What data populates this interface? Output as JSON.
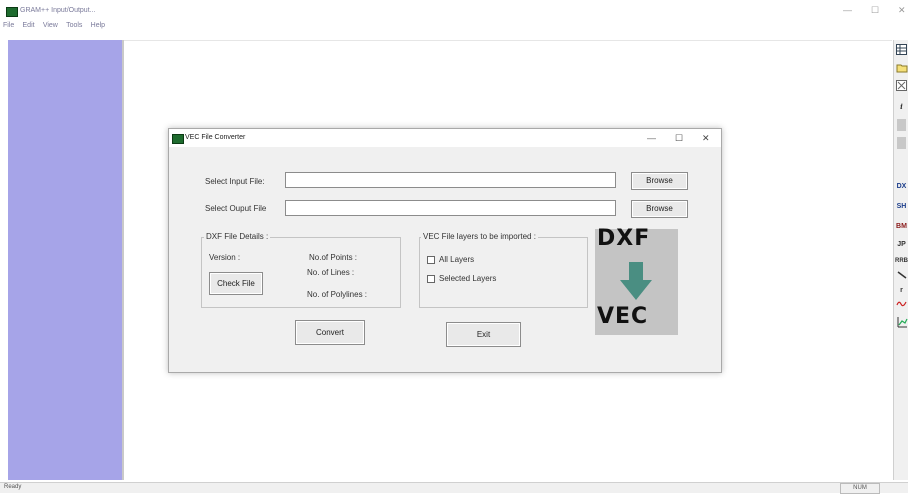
{
  "main_window": {
    "title": "GRAM++ Input/Output...",
    "menu": [
      "File",
      "Edit",
      "View",
      "Tools",
      "Help"
    ],
    "controls": {
      "minimize": "—",
      "restore": "☐",
      "close": "✕"
    }
  },
  "right_toolbar": {
    "icons": [
      "table-icon",
      "open-folder-icon",
      "close-box-icon",
      "info-icon",
      "blank-icon",
      "blank-icon",
      "dxf-icon",
      "shape-icon",
      "bitmap-icon",
      "jpg-icon",
      "rrb-icon",
      "line-icon",
      "r-icon",
      "wave-icon",
      "graph-icon"
    ],
    "labels": {
      "info": "i",
      "dxf": "DX",
      "shp": "SH",
      "bmp": "BM",
      "jpg": "JP",
      "rrb": "RRB",
      "r": "r"
    }
  },
  "statusbar": {
    "left": "Ready",
    "right": "NUM"
  },
  "dialog": {
    "title": "VEC File Converter",
    "controls": {
      "minimize": "—",
      "maximize": "☐",
      "close": "✕"
    },
    "input_label": "Select Input File:",
    "input_value": "",
    "output_label": "Select Ouput File",
    "output_value": "",
    "browse1": "Browse",
    "browse2": "Browse",
    "dxf_group": {
      "title": "DXF File Details :",
      "version_label": "Version :",
      "points_label": "No.of Points :",
      "lines_label": "No. of Lines :",
      "polylines_label": "No. of Polylines :",
      "check_button": "Check File"
    },
    "layers_group": {
      "title": "VEC File layers to be imported :",
      "all_layers": "All Layers",
      "all_layers_checked": false,
      "selected_layers": "Selected Layers",
      "selected_layers_checked": false
    },
    "graphic": {
      "top_text": "DXF",
      "bottom_text": "VEC",
      "arrow_color": "#4a8e82",
      "background": "#c4c4c4"
    },
    "convert_button": "Convert",
    "exit_button": "Exit"
  },
  "colors": {
    "left_panel": "#a6a4e8",
    "accent": "#4a8e82"
  }
}
